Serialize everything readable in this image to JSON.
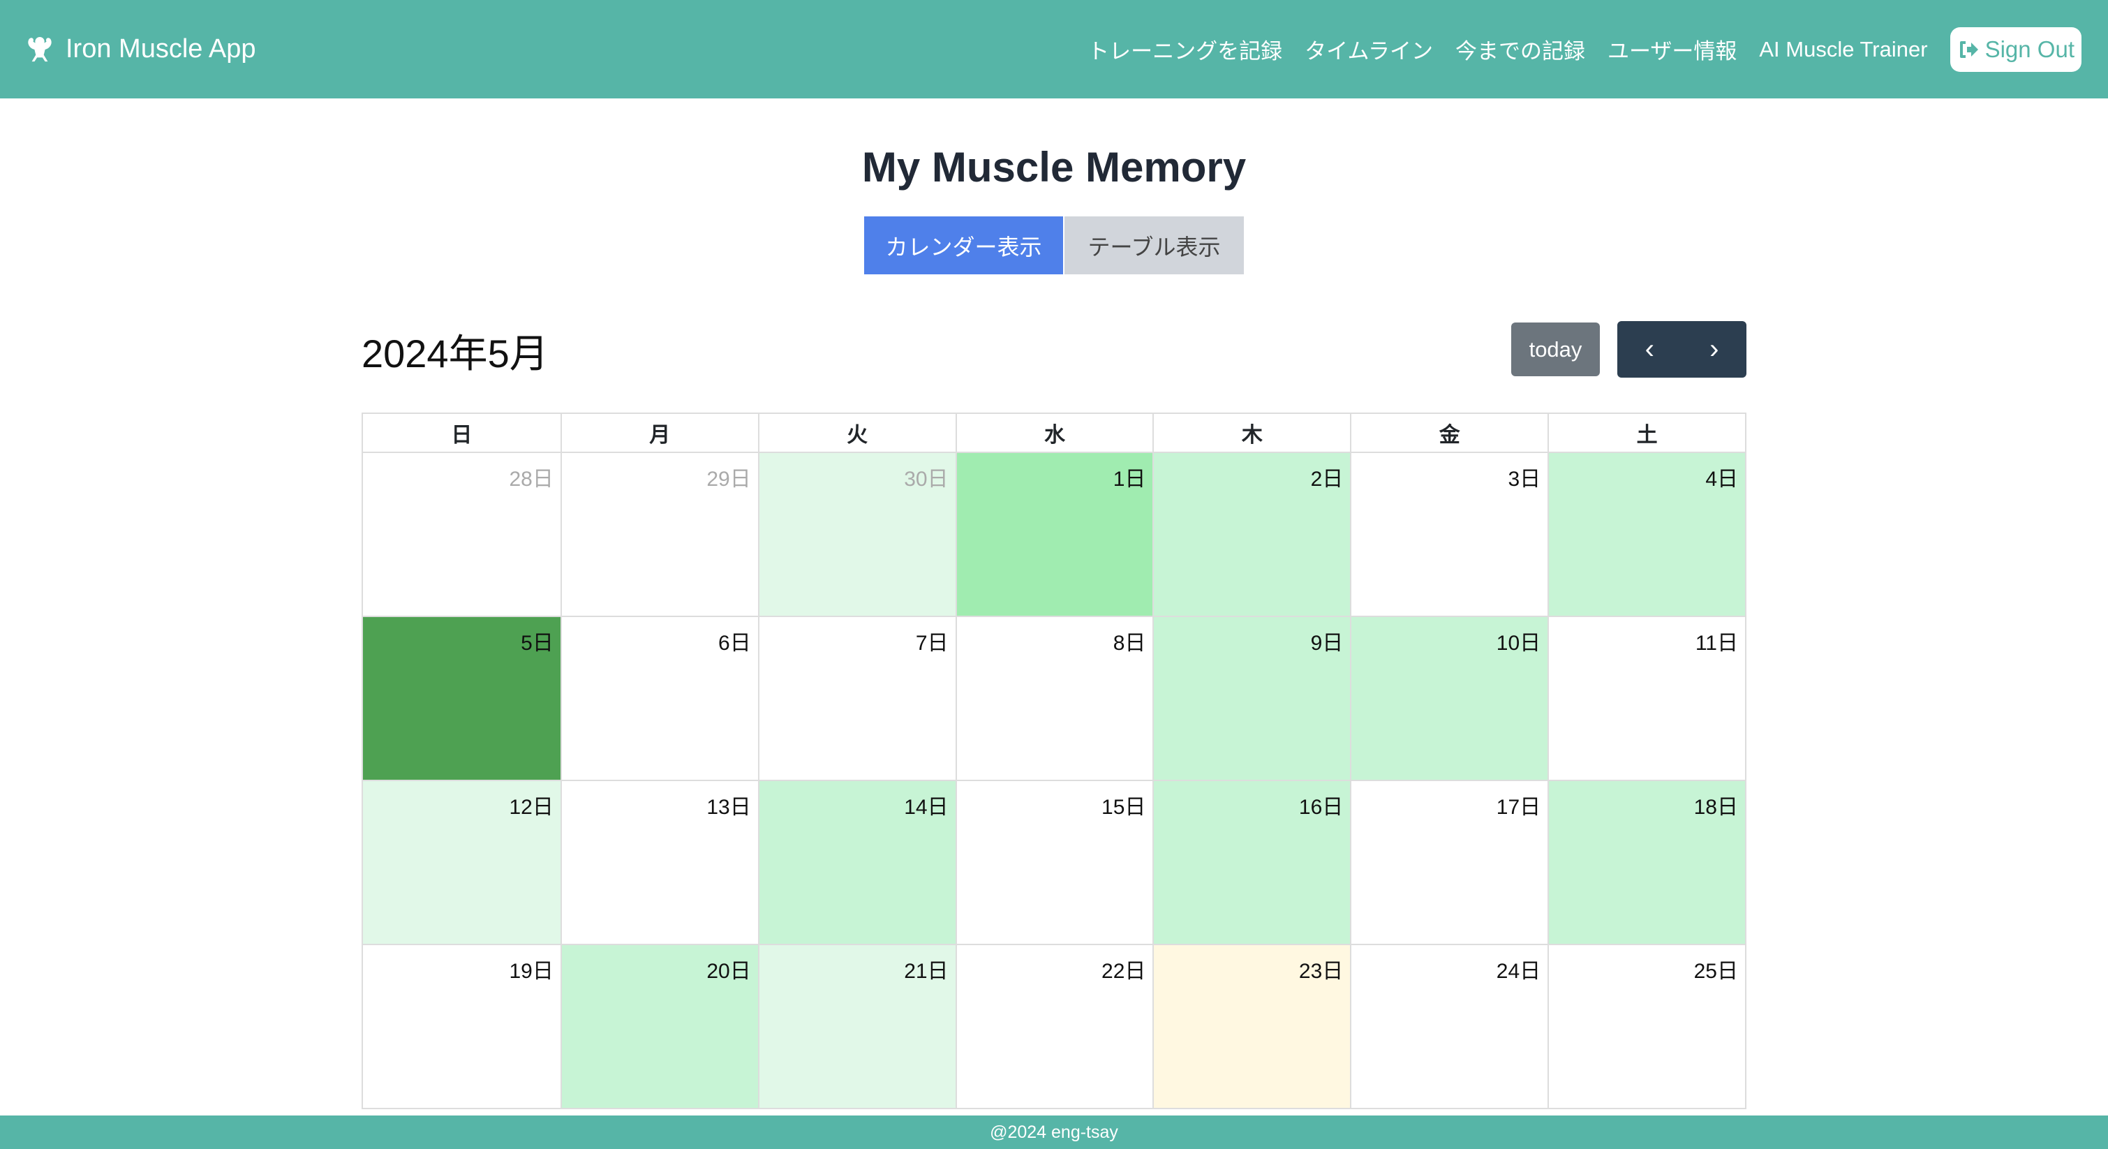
{
  "nav": {
    "brand": "Iron Muscle App",
    "links": [
      "トレーニングを記録",
      "タイムライン",
      "今までの記録",
      "ユーザー情報",
      "AI Muscle Trainer"
    ],
    "sign_out": "Sign Out"
  },
  "page_title": "My Muscle Memory",
  "view_toggle": {
    "calendar": "カレンダー表示",
    "table": "テーブル表示"
  },
  "calendar": {
    "month_title": "2024年5月",
    "today": "today",
    "weekdays": [
      "日",
      "月",
      "火",
      "水",
      "木",
      "金",
      "土"
    ],
    "colors": {
      "none": "#ffffff",
      "light": "#e1f8e8",
      "mid": "#c7f4d5",
      "high": "#a0ecb0",
      "max": "#4ea152",
      "today": "#fff8e1"
    },
    "weeks": [
      [
        {
          "d": "28日",
          "o": true,
          "l": "none"
        },
        {
          "d": "29日",
          "o": true,
          "l": "none"
        },
        {
          "d": "30日",
          "o": true,
          "l": "light"
        },
        {
          "d": "1日",
          "l": "high"
        },
        {
          "d": "2日",
          "l": "mid"
        },
        {
          "d": "3日",
          "l": "none"
        },
        {
          "d": "4日",
          "l": "mid"
        }
      ],
      [
        {
          "d": "5日",
          "l": "max"
        },
        {
          "d": "6日",
          "l": "none"
        },
        {
          "d": "7日",
          "l": "none"
        },
        {
          "d": "8日",
          "l": "none"
        },
        {
          "d": "9日",
          "l": "mid"
        },
        {
          "d": "10日",
          "l": "mid"
        },
        {
          "d": "11日",
          "l": "none"
        }
      ],
      [
        {
          "d": "12日",
          "l": "light"
        },
        {
          "d": "13日",
          "l": "none"
        },
        {
          "d": "14日",
          "l": "mid"
        },
        {
          "d": "15日",
          "l": "none"
        },
        {
          "d": "16日",
          "l": "mid"
        },
        {
          "d": "17日",
          "l": "none"
        },
        {
          "d": "18日",
          "l": "mid"
        }
      ],
      [
        {
          "d": "19日",
          "l": "none"
        },
        {
          "d": "20日",
          "l": "mid"
        },
        {
          "d": "21日",
          "l": "light"
        },
        {
          "d": "22日",
          "l": "none"
        },
        {
          "d": "23日",
          "l": "today"
        },
        {
          "d": "24日",
          "l": "none"
        },
        {
          "d": "25日",
          "l": "none"
        }
      ]
    ]
  },
  "footer": "@2024 eng-tsay"
}
